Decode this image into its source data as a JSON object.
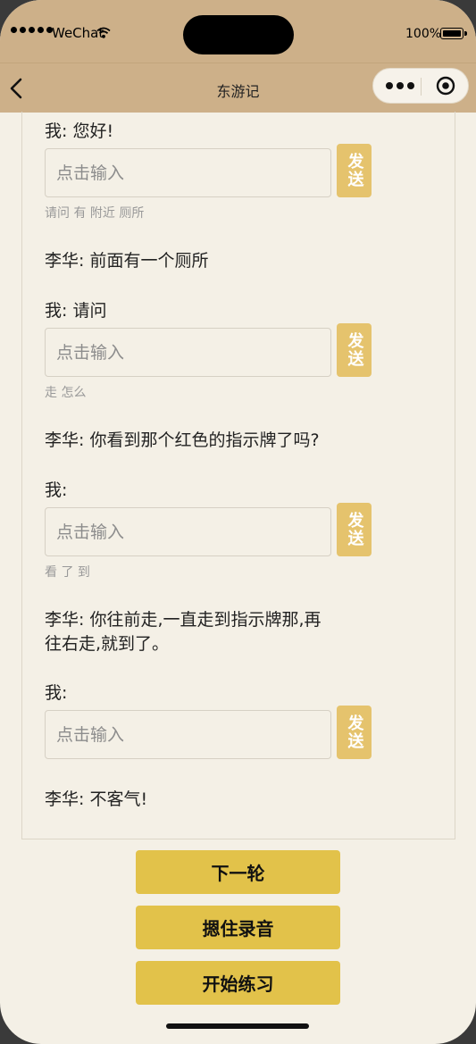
{
  "status_bar": {
    "carrier": "WeChat",
    "battery": "100%"
  },
  "nav": {
    "title": "东游记"
  },
  "dialog": [
    {
      "kind": "me",
      "text": "我: 您好!"
    },
    {
      "kind": "input",
      "placeholder": "点击输入",
      "send": "发送",
      "hint": "请问 有 附近 厕所"
    },
    {
      "kind": "other",
      "text": "李华: 前面有一个厕所"
    },
    {
      "kind": "me",
      "text": "我: 请问"
    },
    {
      "kind": "input",
      "placeholder": "点击输入",
      "send": "发送",
      "hint": "走 怎么"
    },
    {
      "kind": "other",
      "text": "李华: 你看到那个红色的指示牌了吗?"
    },
    {
      "kind": "me",
      "text": "我:"
    },
    {
      "kind": "input",
      "placeholder": "点击输入",
      "send": "发送",
      "hint": "看 了 到"
    },
    {
      "kind": "other",
      "text_line1": "李华: 你往前走,一直走到指示牌那,再",
      "text_line2": "往右走,就到了。"
    },
    {
      "kind": "me",
      "text": "我:"
    },
    {
      "kind": "input",
      "placeholder": "点击输入",
      "send": "发送",
      "hint": ""
    },
    {
      "kind": "other",
      "text": "李华: 不客气!"
    }
  ],
  "actions": {
    "next_round": "下一轮",
    "hold_to_record": "摁住录音",
    "start_practice": "开始练习"
  },
  "colors": {
    "header": "#cdb089",
    "background": "#f4f0e6",
    "send_button": "#e5c36d",
    "action_button": "#e2c24a"
  }
}
